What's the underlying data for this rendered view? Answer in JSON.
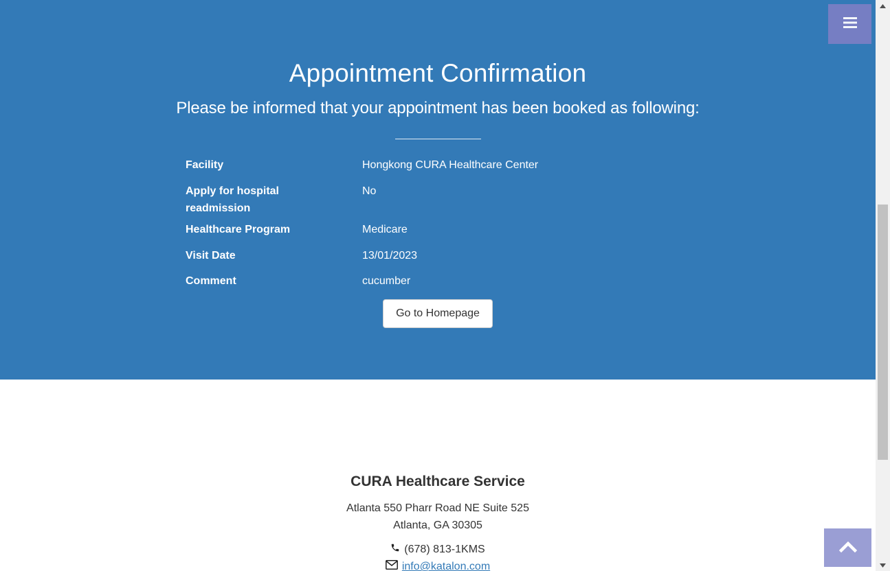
{
  "header": {
    "title": "Appointment Confirmation",
    "subtitle": "Please be informed that your appointment has been booked as following:"
  },
  "details": [
    {
      "label": "Facility",
      "value": "Hongkong CURA Healthcare Center"
    },
    {
      "label": "Apply for hospital readmission",
      "value": "No"
    },
    {
      "label": "Healthcare Program",
      "value": "Medicare"
    },
    {
      "label": "Visit Date",
      "value": "13/01/2023"
    },
    {
      "label": "Comment",
      "value": "cucumber"
    }
  ],
  "actions": {
    "home_button": "Go to Homepage"
  },
  "footer": {
    "company": "CURA Healthcare Service",
    "address_line1": "Atlanta 550 Pharr Road NE Suite 525",
    "address_line2": "Atlanta, GA 30305",
    "phone": "(678) 813-1KMS",
    "email": "info@katalon.com"
  },
  "icons": {
    "menu": "bars-icon",
    "scroll_top": "chevron-up-icon",
    "phone": "phone-icon",
    "email": "envelope-icon"
  },
  "colors": {
    "hero_background": "#337ab7",
    "menu_button": "#7a7fc4",
    "link": "#337ab7"
  }
}
